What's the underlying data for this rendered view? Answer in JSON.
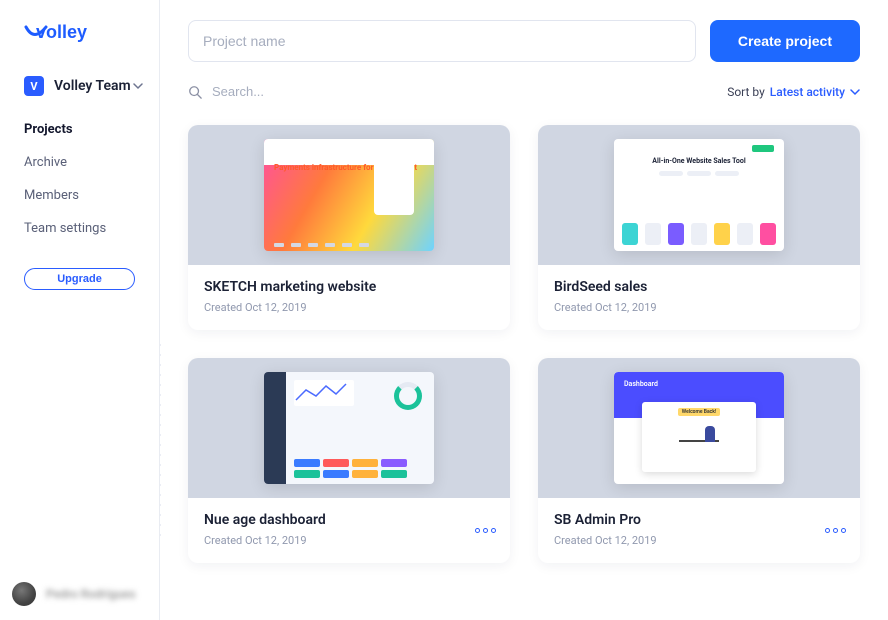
{
  "brand": "volley",
  "team": {
    "initial": "V",
    "name": "Volley Team"
  },
  "nav": {
    "projects": "Projects",
    "archive": "Archive",
    "members": "Members",
    "settings": "Team settings"
  },
  "upgrade_label": "Upgrade",
  "user": {
    "display_name": "Pedro Rodrigues"
  },
  "top": {
    "project_name_placeholder": "Project name",
    "create_label": "Create project"
  },
  "search": {
    "placeholder": "Search..."
  },
  "sort": {
    "label": "Sort by",
    "value": "Latest activity"
  },
  "projects": [
    {
      "title": "SKETCH marketing website",
      "meta": "Created Oct 12, 2019",
      "thumb_text": "Payments infrastructure for the internet"
    },
    {
      "title": "BirdSeed sales",
      "meta": "Created Oct 12, 2019",
      "thumb_text": "All-in-One Website Sales Tool"
    },
    {
      "title": "Nue age dashboard",
      "meta": "Created Oct 12, 2019"
    },
    {
      "title": "SB Admin Pro",
      "meta": "Created Oct 12, 2019",
      "thumb_text": "Dashboard",
      "thumb_welcome": "Welcome Back!"
    }
  ],
  "colors": {
    "accent": "#1e69ff"
  }
}
